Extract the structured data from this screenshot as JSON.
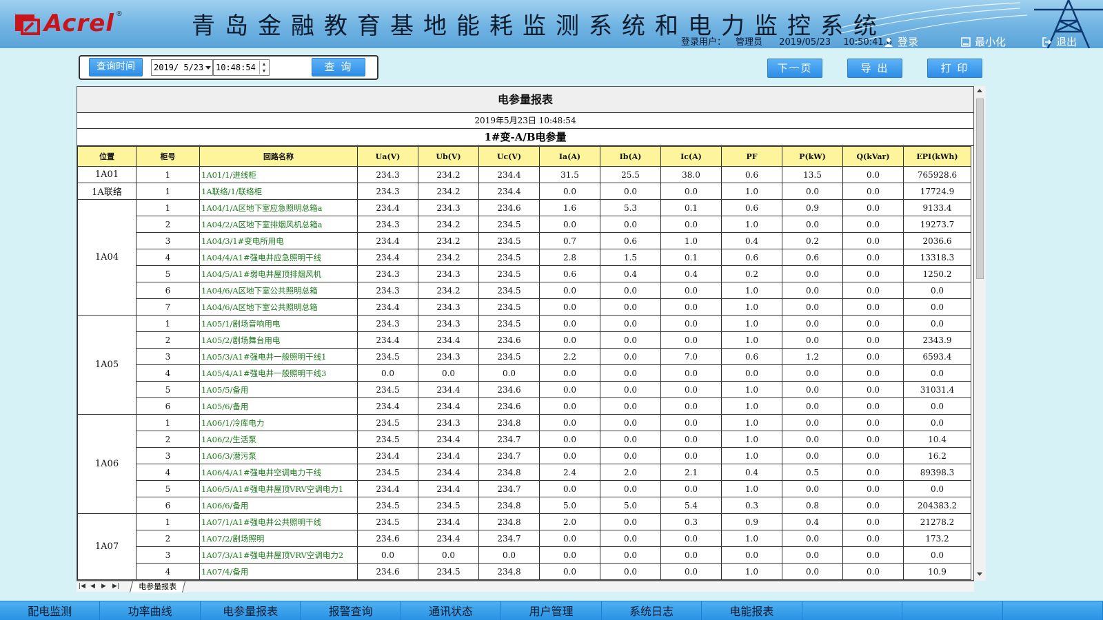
{
  "header": {
    "logo_text": "Acrel",
    "logo_reg": "®",
    "title": "青岛金融教育基地能耗监测系统和电力监控系统",
    "user_label": "登录用户：",
    "user_name": "管理员",
    "date": "2019/05/23",
    "time": "10:50:41.6",
    "login_label": "登录",
    "minimize_label": "最小化",
    "exit_label": "退出"
  },
  "query": {
    "query_time_label": "查询时间",
    "date_value": "2019/ 5/23",
    "time_value": "10:48:54",
    "query_button": "查 询"
  },
  "toolbar": {
    "next_page": "下一页",
    "export": "导 出",
    "print": "打 印"
  },
  "report": {
    "title": "电参量报表",
    "datetime": "2019年5月23日 10:48:54",
    "subtitle": "1#变-A/B电参量",
    "columns": [
      "位置",
      "柜号",
      "回路名称",
      "Ua(V)",
      "Ub(V)",
      "Uc(V)",
      "Ia(A)",
      "Ib(A)",
      "Ic(A)",
      "PF",
      "P(kW)",
      "Q(kVar)",
      "EPI(kWh)"
    ],
    "groups": [
      {
        "location": "1A01",
        "rows": [
          [
            "1",
            "1A01/1/进线柜",
            "234.3",
            "234.2",
            "234.4",
            "31.5",
            "25.5",
            "38.0",
            "0.6",
            "13.5",
            "0.0",
            "765928.6"
          ]
        ]
      },
      {
        "location": "1A联络",
        "rows": [
          [
            "1",
            "1A联络/1/联络柜",
            "234.3",
            "234.2",
            "234.4",
            "0.0",
            "0.0",
            "0.0",
            "1.0",
            "0.0",
            "0.0",
            "17724.9"
          ]
        ]
      },
      {
        "location": "1A04",
        "rows": [
          [
            "1",
            "1A04/1/A区地下室应急照明总箱a",
            "234.4",
            "234.3",
            "234.6",
            "1.6",
            "5.3",
            "0.1",
            "0.6",
            "0.9",
            "0.0",
            "9133.4"
          ],
          [
            "2",
            "1A04/2/A区地下室排烟风机总箱a",
            "234.3",
            "234.2",
            "234.5",
            "0.0",
            "0.0",
            "0.0",
            "1.0",
            "0.0",
            "0.0",
            "19273.7"
          ],
          [
            "3",
            "1A04/3/1#变电所用电",
            "234.4",
            "234.2",
            "234.5",
            "0.7",
            "0.6",
            "1.0",
            "0.4",
            "0.2",
            "0.0",
            "2036.6"
          ],
          [
            "4",
            "1A04/4/A1#强电井应急照明干线",
            "234.4",
            "234.2",
            "234.5",
            "2.8",
            "1.5",
            "0.1",
            "0.6",
            "0.6",
            "0.0",
            "13318.3"
          ],
          [
            "5",
            "1A04/5/A1#弱电井屋顶排烟风机",
            "234.3",
            "234.3",
            "234.5",
            "0.6",
            "0.4",
            "0.4",
            "0.2",
            "0.0",
            "0.0",
            "1250.2"
          ],
          [
            "6",
            "1A04/6/A区地下室公共照明总箱",
            "234.3",
            "234.2",
            "234.5",
            "0.0",
            "0.0",
            "0.0",
            "1.0",
            "0.0",
            "0.0",
            "0.0"
          ],
          [
            "7",
            "1A04/6/A区地下室公共照明总箱",
            "234.4",
            "234.3",
            "234.5",
            "0.0",
            "0.0",
            "0.0",
            "1.0",
            "0.0",
            "0.0",
            "0.0"
          ]
        ]
      },
      {
        "location": "1A05",
        "rows": [
          [
            "1",
            "1A05/1/剧场音响用电",
            "234.3",
            "234.3",
            "234.5",
            "0.0",
            "0.0",
            "0.0",
            "1.0",
            "0.0",
            "0.0",
            "0.0"
          ],
          [
            "2",
            "1A05/2/剧场舞台用电",
            "234.4",
            "234.4",
            "234.6",
            "0.0",
            "0.0",
            "0.0",
            "1.0",
            "0.0",
            "0.0",
            "2343.9"
          ],
          [
            "3",
            "1A05/3/A1#强电井一般照明干线1",
            "234.5",
            "234.3",
            "234.5",
            "2.2",
            "0.0",
            "7.0",
            "0.6",
            "1.2",
            "0.0",
            "6593.4"
          ],
          [
            "4",
            "1A05/4/A1#强电井一般照明干线3",
            "0.0",
            "0.0",
            "0.0",
            "0.0",
            "0.0",
            "0.0",
            "0.0",
            "0.0",
            "0.0",
            "0.0"
          ],
          [
            "5",
            "1A05/5/备用",
            "234.5",
            "234.4",
            "234.6",
            "0.0",
            "0.0",
            "0.0",
            "1.0",
            "0.0",
            "0.0",
            "31031.4"
          ],
          [
            "6",
            "1A05/6/备用",
            "234.4",
            "234.4",
            "234.6",
            "0.0",
            "0.0",
            "0.0",
            "1.0",
            "0.0",
            "0.0",
            "0.0"
          ]
        ]
      },
      {
        "location": "1A06",
        "rows": [
          [
            "1",
            "1A06/1/冷库电力",
            "234.5",
            "234.3",
            "234.8",
            "0.0",
            "0.0",
            "0.0",
            "1.0",
            "0.0",
            "0.0",
            "0.0"
          ],
          [
            "2",
            "1A06/2/生活泵",
            "234.5",
            "234.4",
            "234.7",
            "0.0",
            "0.0",
            "0.0",
            "1.0",
            "0.0",
            "0.0",
            "10.4"
          ],
          [
            "3",
            "1A06/3/潜污泵",
            "234.4",
            "234.4",
            "234.7",
            "0.0",
            "0.0",
            "0.0",
            "1.0",
            "0.0",
            "0.0",
            "16.2"
          ],
          [
            "4",
            "1A06/4/A1#强电井空调电力干线",
            "234.5",
            "234.4",
            "234.8",
            "2.4",
            "2.0",
            "2.1",
            "0.4",
            "0.5",
            "0.0",
            "89398.3"
          ],
          [
            "5",
            "1A06/5/A1#强电井屋顶VRV空调电力1",
            "234.4",
            "234.4",
            "234.7",
            "0.0",
            "0.0",
            "0.0",
            "1.0",
            "0.0",
            "0.0",
            "0.0"
          ],
          [
            "6",
            "1A06/6/备用",
            "234.5",
            "234.5",
            "234.8",
            "5.0",
            "5.0",
            "5.4",
            "0.3",
            "0.8",
            "0.0",
            "204383.2"
          ]
        ]
      },
      {
        "location": "1A07",
        "rows": [
          [
            "1",
            "1A07/1/A1#强电井公共照明干线",
            "234.5",
            "234.4",
            "234.8",
            "2.0",
            "0.0",
            "0.3",
            "0.9",
            "0.4",
            "0.0",
            "21278.2"
          ],
          [
            "2",
            "1A07/2/剧场照明",
            "234.6",
            "234.4",
            "234.7",
            "0.0",
            "0.0",
            "0.0",
            "1.0",
            "0.0",
            "0.0",
            "173.2"
          ],
          [
            "3",
            "1A07/3/A1#强电井屋顶VRV空调电力2",
            "0.0",
            "0.0",
            "0.0",
            "0.0",
            "0.0",
            "0.0",
            "0.0",
            "0.0",
            "0.0",
            "0.0"
          ],
          [
            "4",
            "1A07/4/备用",
            "234.6",
            "234.5",
            "234.8",
            "0.0",
            "0.0",
            "0.0",
            "1.0",
            "0.0",
            "0.0",
            "10.9"
          ]
        ]
      }
    ]
  },
  "sheet_tab": "电参量报表",
  "bottom_nav": [
    "配电监测",
    "功率曲线",
    "电参量报表",
    "报警查询",
    "通讯状态",
    "用户管理",
    "系统日志",
    "电能报表",
    "",
    "",
    ""
  ],
  "colors": {
    "header_bg": "#6fb3e2",
    "button_blue": "#2c8ee8",
    "table_header_yellow": "#fdf49b",
    "circuit_name_green": "#1d7a1d",
    "page_bg": "#d6f2f7",
    "logo_red": "#c8151b"
  }
}
